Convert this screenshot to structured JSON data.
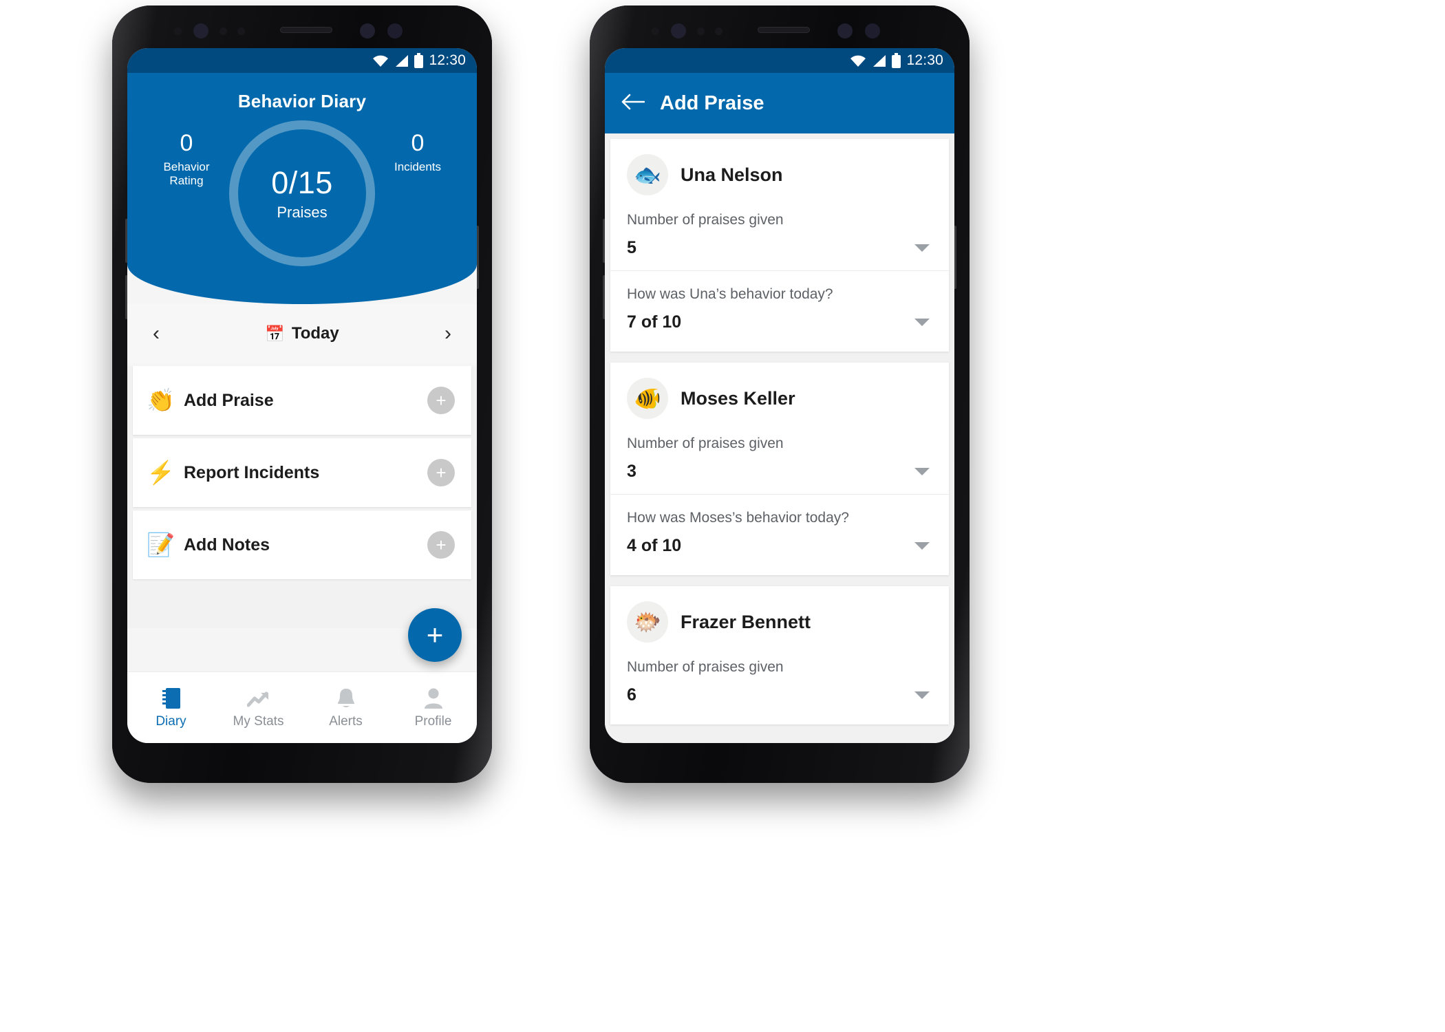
{
  "left_phone": {
    "status_bar": {
      "time": "12:30",
      "icons": [
        "wifi-icon",
        "signal-icon",
        "battery-icon"
      ]
    },
    "hero": {
      "title": "Behavior Diary",
      "left_stat": {
        "value": "0",
        "label": "Behavior Rating"
      },
      "right_stat": {
        "value": "0",
        "label": "Incidents"
      },
      "ring": {
        "value": "0/15",
        "label": "Praises"
      }
    },
    "date_nav": {
      "prev": "‹",
      "next": "›",
      "calendar_icon": "📅",
      "label": "Today"
    },
    "actions": [
      {
        "emoji": "👏",
        "label": "Add Praise",
        "add": "+"
      },
      {
        "emoji": "⚡",
        "label": "Report Incidents",
        "add": "+"
      },
      {
        "emoji": "📝",
        "label": "Add Notes",
        "add": "+"
      }
    ],
    "fab": {
      "label": "+"
    },
    "bottom_nav": [
      {
        "icon": "diary-icon",
        "label": "Diary",
        "active": true
      },
      {
        "icon": "trending-up-icon",
        "label": "My Stats",
        "active": false
      },
      {
        "icon": "bell-icon",
        "label": "Alerts",
        "active": false
      },
      {
        "icon": "person-icon",
        "label": "Profile",
        "active": false
      }
    ]
  },
  "right_phone": {
    "status_bar": {
      "time": "12:30",
      "icons": [
        "wifi-icon",
        "signal-icon",
        "battery-icon"
      ]
    },
    "appbar": {
      "back_icon": "back-arrow-icon",
      "title": "Add Praise"
    },
    "students": [
      {
        "avatar_emoji": "🐟",
        "name": "Una Nelson",
        "praises_label": "Number of praises given",
        "praises_value": "5",
        "behavior_label": "How was Una’s behavior today?",
        "behavior_value": "7 of 10"
      },
      {
        "avatar_emoji": "🐠",
        "name": "Moses Keller",
        "praises_label": "Number of praises given",
        "praises_value": "3",
        "behavior_label": "How was Moses’s behavior today?",
        "behavior_value": "4 of 10"
      },
      {
        "avatar_emoji": "🐡",
        "name": "Frazer Bennett",
        "praises_label": "Number of praises given",
        "praises_value": "6",
        "behavior_label": "",
        "behavior_value": ""
      }
    ]
  },
  "colors": {
    "brand_blue": "#0369ac",
    "status_blue": "#014a80",
    "accent_gray": "#c9c9c9",
    "nav_active": "#0d6db3"
  }
}
